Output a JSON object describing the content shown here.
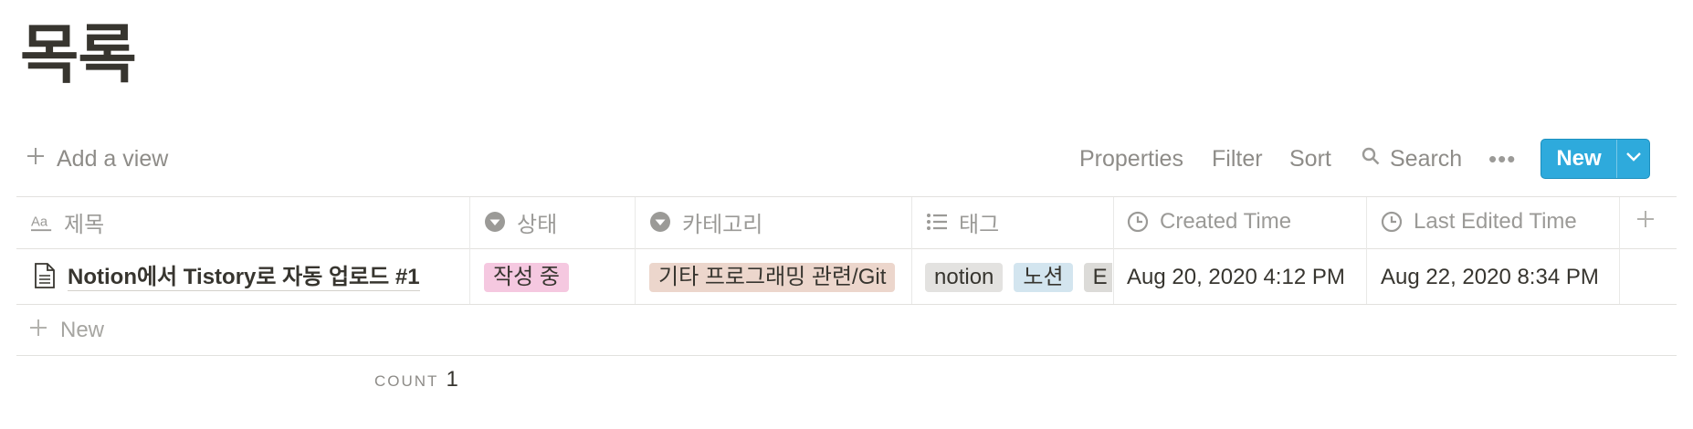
{
  "page": {
    "title": "목록"
  },
  "toolbar": {
    "add_view": "Add a view",
    "properties": "Properties",
    "filter": "Filter",
    "sort": "Sort",
    "search": "Search",
    "more": "•••",
    "new": "New"
  },
  "table": {
    "columns": [
      {
        "label": "제목",
        "icon": "text-property-icon"
      },
      {
        "label": "상태",
        "icon": "select-property-icon"
      },
      {
        "label": "카테고리",
        "icon": "select-property-icon"
      },
      {
        "label": "태그",
        "icon": "multi-select-property-icon"
      },
      {
        "label": "Created Time",
        "icon": "clock-icon"
      },
      {
        "label": "Last Edited Time",
        "icon": "clock-icon"
      }
    ],
    "rows": [
      {
        "title": "Notion에서 Tistory로 자동 업로드 #1",
        "status": "작성 중",
        "category": "기타 프로그래밍 관련/Git",
        "tags": [
          "notion",
          "노션",
          "E"
        ],
        "created": "Aug 20, 2020 4:12 PM",
        "edited": "Aug 22, 2020 8:34 PM"
      }
    ],
    "new_row": "New"
  },
  "footer": {
    "count_label": "COUNT",
    "count_value": "1"
  },
  "colors": {
    "accent": "#2eaadc",
    "status_tag": "#f5c8e0",
    "category_tag": "#ecd6cc",
    "tag_notion": "#e3e2e0",
    "tag_noseon": "#d3e5ef",
    "tag_e": "#dcdbd8"
  }
}
